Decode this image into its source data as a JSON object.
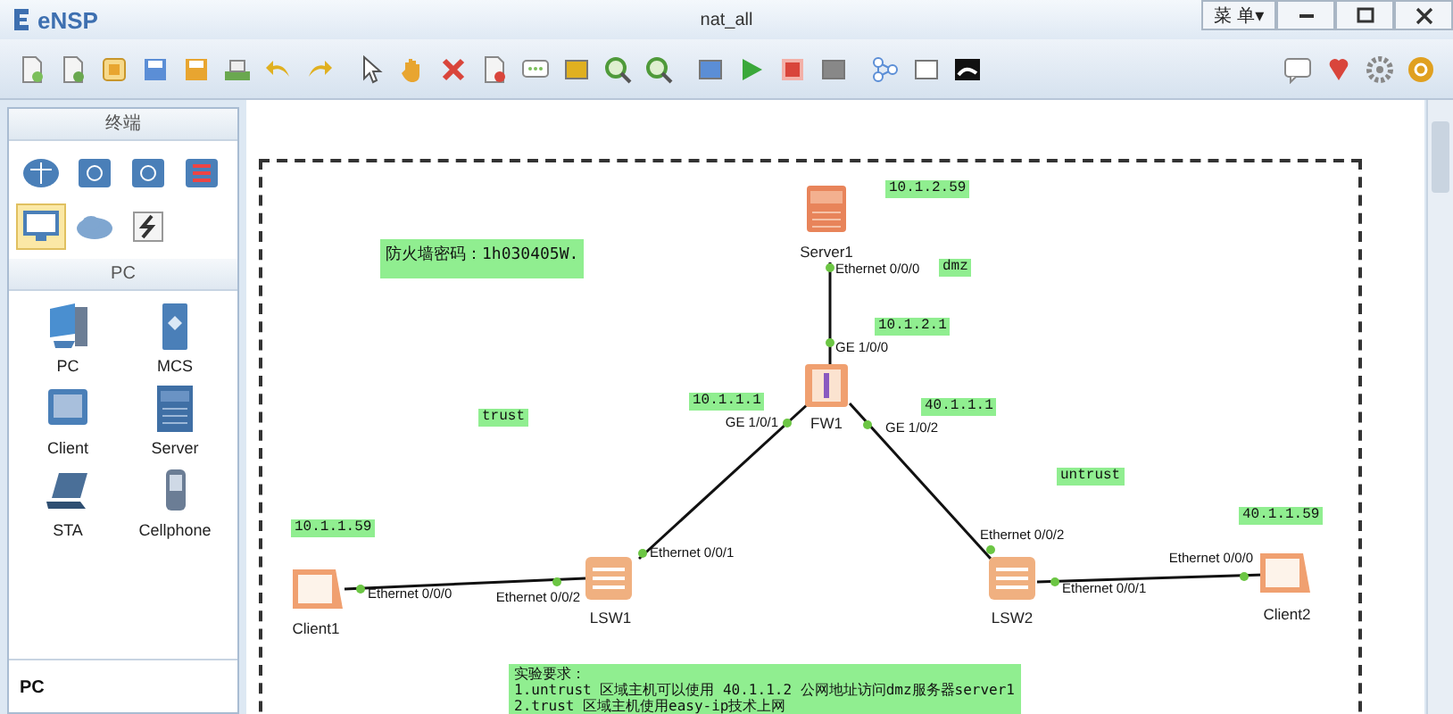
{
  "window": {
    "app_name": "eNSP",
    "title": "nat_all",
    "menu_button": "菜 单▾"
  },
  "palette": {
    "header": "终端",
    "categories": [
      {
        "kind": "router",
        "selected": false
      },
      {
        "kind": "switch",
        "selected": false
      },
      {
        "kind": "wireless",
        "selected": false
      },
      {
        "kind": "firewall",
        "selected": false
      },
      {
        "kind": "terminal",
        "selected": true
      },
      {
        "kind": "cloud",
        "selected": false
      },
      {
        "kind": "cable",
        "selected": false
      }
    ],
    "section_title": "PC",
    "devices": [
      {
        "kind": "pc",
        "label": "PC"
      },
      {
        "kind": "mcs",
        "label": "MCS"
      },
      {
        "kind": "client",
        "label": "Client"
      },
      {
        "kind": "server",
        "label": "Server"
      },
      {
        "kind": "sta",
        "label": "STA"
      },
      {
        "kind": "cellphone",
        "label": "Cellphone"
      }
    ],
    "footer_title": "PC"
  },
  "topology": {
    "nodes": [
      {
        "kind": "server",
        "label": "Server1"
      },
      {
        "kind": "firewall",
        "label": "FW1"
      },
      {
        "kind": "switch",
        "label": "LSW1"
      },
      {
        "kind": "switch",
        "label": "LSW2"
      },
      {
        "kind": "client",
        "label": "Client1"
      },
      {
        "kind": "client",
        "label": "Client2"
      }
    ],
    "links": [
      {
        "ports": [
          "Ethernet 0/0/0",
          "GE 1/0/0"
        ]
      },
      {
        "ports": [
          "GE 1/0/1",
          "Ethernet 0/0/1"
        ]
      },
      {
        "ports": [
          "GE 1/0/2",
          "Ethernet 0/0/2"
        ]
      },
      {
        "ports": [
          "Ethernet 0/0/0",
          "Ethernet 0/0/2"
        ]
      },
      {
        "ports": [
          "Ethernet 0/0/1",
          "Ethernet 0/0/0"
        ]
      }
    ],
    "notes": [
      {
        "lines": [
          "10.1.2.59"
        ]
      },
      {
        "lines": [
          "防火墙密码：1h030405W."
        ]
      },
      {
        "lines": [
          "dmz"
        ]
      },
      {
        "lines": [
          "10.1.2.1"
        ]
      },
      {
        "lines": [
          "10.1.1.1"
        ]
      },
      {
        "lines": [
          "trust"
        ]
      },
      {
        "lines": [
          "40.1.1.1"
        ]
      },
      {
        "lines": [
          "untrust"
        ]
      },
      {
        "lines": [
          "10.1.1.59"
        ]
      },
      {
        "lines": [
          "40.1.1.59"
        ]
      },
      {
        "lines": [
          "实验要求：",
          "1.untrust 区域主机可以使用 40.1.1.2 公网地址访问dmz服务器server1",
          "2.trust 区域主机使用easy-ip技术上网"
        ]
      }
    ]
  }
}
